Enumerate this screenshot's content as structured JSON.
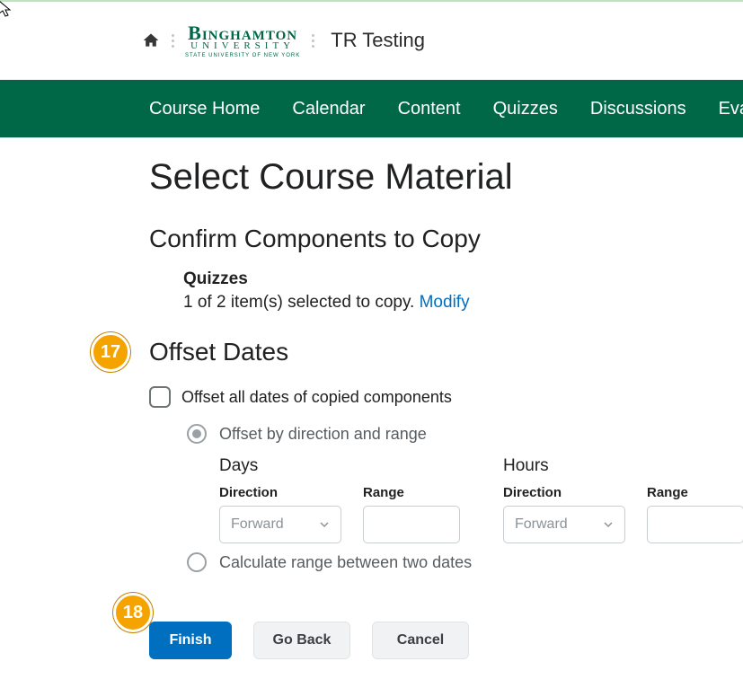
{
  "topbar": {
    "logo_line1": "Binghamton",
    "logo_line2": "UNIVERSITY",
    "logo_line3": "State University of New York",
    "course_name": "TR Testing"
  },
  "nav": {
    "items": [
      "Course Home",
      "Calendar",
      "Content",
      "Quizzes",
      "Discussions",
      "Evaluation"
    ]
  },
  "page": {
    "title": "Select Course Material",
    "confirm_head": "Confirm Components to Copy",
    "component_name": "Quizzes",
    "component_line": "1 of 2 item(s) selected to copy. ",
    "modify_label": "Modify"
  },
  "offset": {
    "heading": "Offset Dates",
    "checkbox_label": "Offset all dates of copied components",
    "radio1": "Offset by direction and range",
    "radio2": "Calculate range between two dates",
    "days_label": "Days",
    "hours_label": "Hours",
    "direction_label": "Direction",
    "range_label": "Range",
    "direction_value": "Forward"
  },
  "footer": {
    "finish": "Finish",
    "goback": "Go Back",
    "cancel": "Cancel"
  },
  "annotations": {
    "a17": "17",
    "a18": "18"
  }
}
